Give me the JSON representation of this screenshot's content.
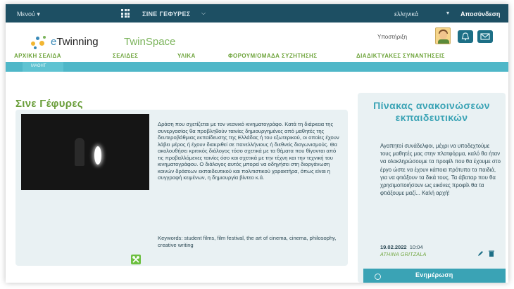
{
  "topbar": {
    "menu_label": "Μενού ▾",
    "space_name": "ΣΙΝΕ ΓΕΦΥΡΕΣ",
    "language": "ελληνικά",
    "logout": "Αποσύνδεση"
  },
  "header": {
    "logo_e": "e",
    "logo_twinning": "Twinning",
    "logo_twinspace": "TwinSpace",
    "support": "Υποστήριξη"
  },
  "nav": {
    "items": [
      "ΑΡΧΙΚΗ ΣΕΛΙΔΑ",
      "ΣΕΛΙΔΕΣ",
      "ΥΛΙΚΑ",
      "ΦΟΡΟΥΜ/ΟΜΑΔΑ ΣΥΖΗΤΗΣΗΣ",
      "ΔΙΑΔΙΚΤΥΑΚΕΣ ΣΥΝΑΝΤΗΣΕΙΣ"
    ],
    "sub_label": "ΜΑΘΗΤ"
  },
  "main": {
    "title": "Σινε Γέφυρες",
    "description": "Δράση που σχετίζεται με τον νεανικό κινηματογράφο. Κατά τη διάρκεια της συνεργασίας θα προβληθούν ταινίες δημιουργημένες από μαθητές της δευτεροβάθμιας εκπαίδευσης της Ελλάδας ή του εξωτερικού, οι οποίες έχουν λάβει μέρος ή έχουν διακριθεί σε πανελλήνιους ή διεθνείς διαγωνισμούς. Θα ακολουθήσει κριτικός διάλογος τόσο σχετικά με τα θέματα που θίγονται από τις προβαλλόμενες ταινίες όσο και σχετικά με την τέχνη και την τεχνική του κινηματογράφου. Ο διάλογος αυτός μπορεί να οδηγήσει στη διοργάνωση κοινών δράσεων εκπαιδευτικού και πολιτιστικού χαρακτήρα, όπως είναι η συγγραφή κειμένων, η δημιουργία βίντεο κ.ά.",
    "keywords": "Keywords: student films, film festival, the art of cinema, cinema, philosophy, creative writing"
  },
  "sidebar": {
    "title": "Πίνακας ανακοινώσεων εκπαιδευτικών",
    "text": "Αγαπητοί συνάδελφοι, μέχρι να υποδεχτούμε τους μαθητές μας στην πλατφόρμα, καλό θα ήταν να ολοκληρώσουμε τα προφίλ που θα έχουμε στο έργο ώστε να έχουν κάποια πρότυπα τα παιδιά, για να φτιάξουν τα δικά τους. Τα άβαταρ που θα χρησιμοποιήσουν ως εικόνες προφίλ θα τα φτιάξουμε μαζί... Καλή αρχή!",
    "date": "19.02.2022",
    "time": "10:04",
    "author": "ATHINA GRITZALA",
    "update_label": "Ενημέρωση"
  }
}
